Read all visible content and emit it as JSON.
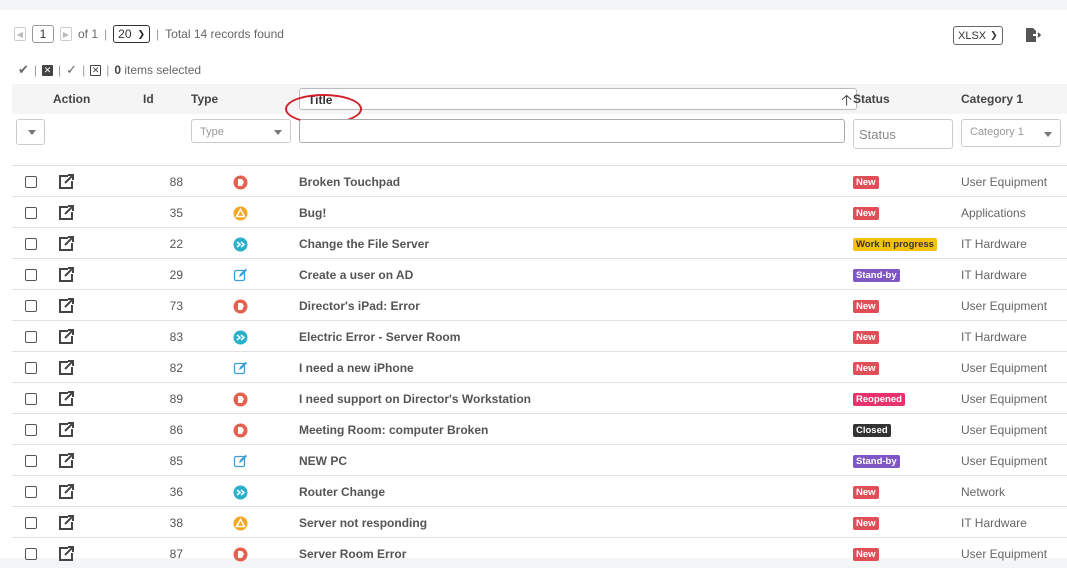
{
  "pagination": {
    "page": "1",
    "of_label": "of 1",
    "page_size": "20",
    "total": "Total 14 records found"
  },
  "export": {
    "format": "XLSX",
    "icon": "export-file-icon"
  },
  "selection": {
    "count": "0",
    "suffix": "items selected"
  },
  "columns": {
    "action": "Action",
    "id": "Id",
    "type": "Type",
    "title": "Title",
    "status": "Status",
    "category": "Category 1"
  },
  "filters": {
    "type_placeholder": "Type",
    "status_placeholder": "Status",
    "category_placeholder": "Category 1"
  },
  "colors": {
    "new": "#e04e58",
    "work_in_progress": "#f4c20d",
    "standby": "#7e57c2",
    "reopened": "#e8336a",
    "closed": "#333333",
    "incident": "#e2624f",
    "request": "#f5a623",
    "change": "#2ab0c8",
    "task": "#3c9fd8"
  },
  "rows": [
    {
      "id": "88",
      "type": "incident",
      "title": "Broken Touchpad",
      "status": "New",
      "status_kind": "new",
      "category": "User Equipment"
    },
    {
      "id": "35",
      "type": "problem",
      "title": "Bug!",
      "status": "New",
      "status_kind": "new",
      "category": "Applications"
    },
    {
      "id": "22",
      "type": "change",
      "title": "Change the File Server",
      "status": "Work in progress",
      "status_kind": "wip",
      "category": "IT Hardware"
    },
    {
      "id": "29",
      "type": "request",
      "title": "Create a user on AD",
      "status": "Stand-by",
      "status_kind": "standby",
      "category": "IT Hardware"
    },
    {
      "id": "73",
      "type": "incident",
      "title": "Director's iPad: Error",
      "status": "New",
      "status_kind": "new",
      "category": "User Equipment"
    },
    {
      "id": "83",
      "type": "change",
      "title": "Electric Error - Server Room",
      "status": "New",
      "status_kind": "new",
      "category": "IT Hardware"
    },
    {
      "id": "82",
      "type": "request",
      "title": "I need a new iPhone",
      "status": "New",
      "status_kind": "new",
      "category": "User Equipment"
    },
    {
      "id": "89",
      "type": "incident",
      "title": "I need support on Director's Workstation",
      "status": "Reopened",
      "status_kind": "reopened",
      "category": "User Equipment"
    },
    {
      "id": "86",
      "type": "incident",
      "title": "Meeting Room: computer Broken",
      "status": "Closed",
      "status_kind": "closed",
      "category": "User Equipment"
    },
    {
      "id": "85",
      "type": "request",
      "title": "NEW PC",
      "status": "Stand-by",
      "status_kind": "standby",
      "category": "User Equipment"
    },
    {
      "id": "36",
      "type": "change",
      "title": "Router Change",
      "status": "New",
      "status_kind": "new",
      "category": "Network"
    },
    {
      "id": "38",
      "type": "problem",
      "title": "Server not responding",
      "status": "New",
      "status_kind": "new",
      "category": "IT Hardware"
    },
    {
      "id": "87",
      "type": "incident",
      "title": "Server Room Error",
      "status": "New",
      "status_kind": "new",
      "category": "User Equipment"
    }
  ]
}
